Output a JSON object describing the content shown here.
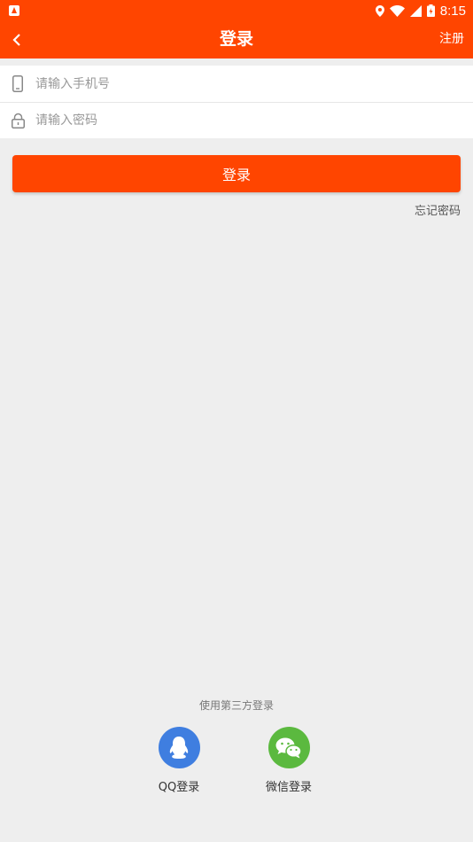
{
  "status_bar": {
    "time": "8:15",
    "icons": [
      "app-notification-icon",
      "location-icon",
      "wifi-icon",
      "signal-icon",
      "battery-icon"
    ]
  },
  "header": {
    "title": "登录",
    "register_label": "注册",
    "back_icon": "chevron-left-icon"
  },
  "form": {
    "phone_placeholder": "请输入手机号",
    "phone_value": "",
    "password_placeholder": "请输入密码",
    "password_value": "",
    "phone_icon": "phone-icon",
    "password_icon": "lock-icon"
  },
  "actions": {
    "login_label": "登录",
    "forgot_label": "忘记密码"
  },
  "third_party": {
    "label": "使用第三方登录",
    "qq_label": "QQ登录",
    "wechat_label": "微信登录"
  },
  "colors": {
    "accent": "#ff4500",
    "background": "#eeeeee",
    "qq": "#3f7ee0",
    "wechat": "#5bb93f"
  }
}
